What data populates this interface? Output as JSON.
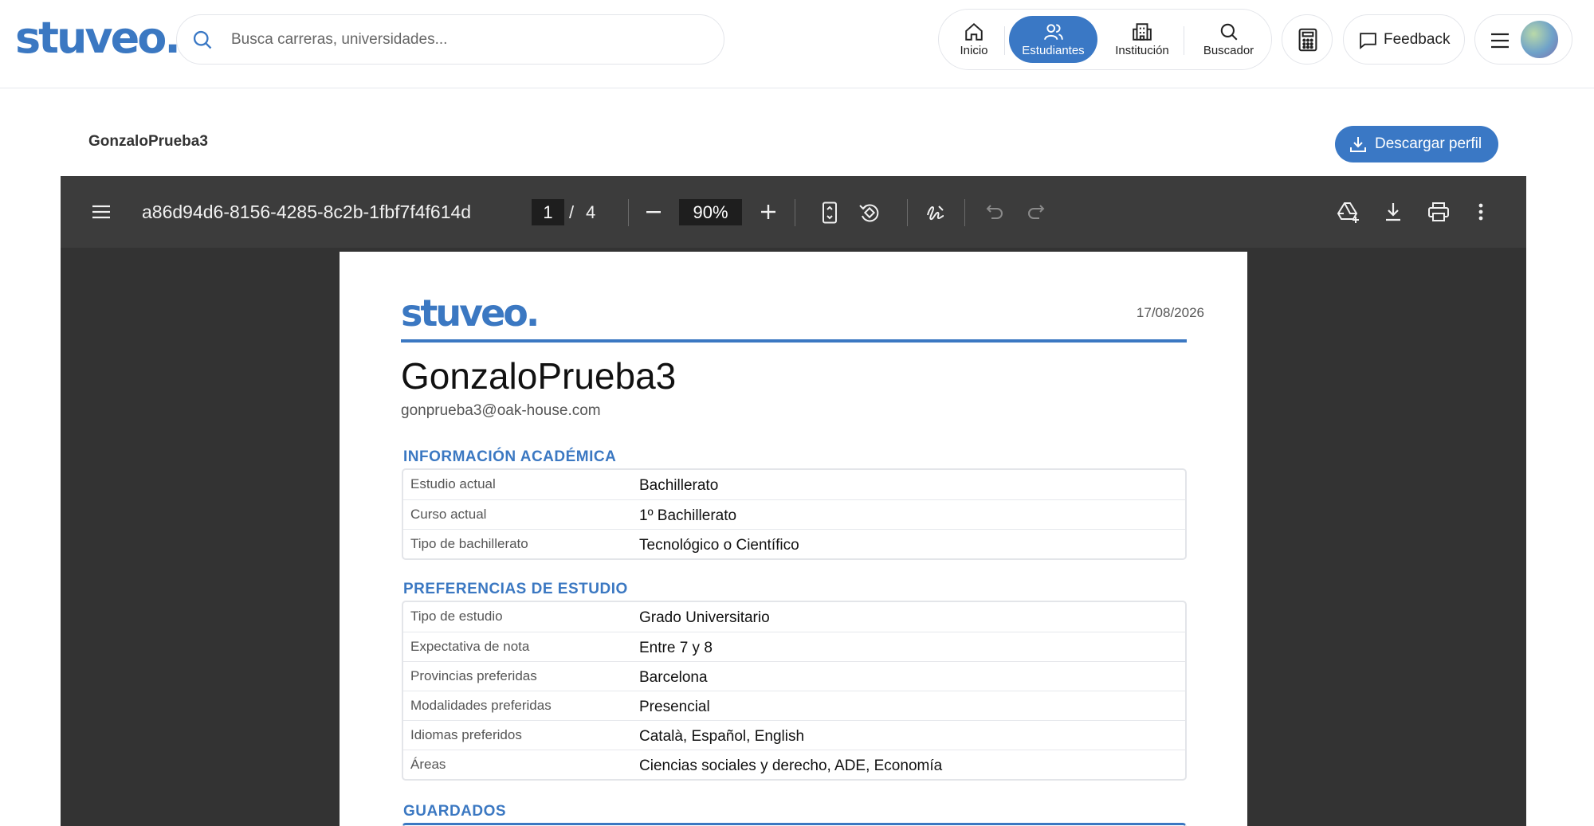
{
  "header": {
    "logo": "stuveo.",
    "search_placeholder": "Busca carreras, universidades...",
    "nav": [
      {
        "label": "Inicio",
        "icon": "home-icon"
      },
      {
        "label": "Estudiantes",
        "icon": "users-icon"
      },
      {
        "label": "Institución",
        "icon": "building-icon"
      },
      {
        "label": "Buscador",
        "icon": "search-icon"
      }
    ],
    "active_nav": "Estudiantes",
    "feedback_label": "Feedback"
  },
  "page": {
    "profile_name": "GonzaloPrueba3",
    "download_label": "Descargar perfil"
  },
  "viewer": {
    "file_name": "a86d94d6-8156-4285-8c2b-1fbf7f4f614d",
    "current_page": "1",
    "page_separator": "/",
    "total_pages": "4",
    "zoom": "90%"
  },
  "pdf": {
    "logo": "stuveo.",
    "date": "17/08/2026",
    "name": "GonzaloPrueba3",
    "email": "gonprueba3@oak-house.com",
    "sections": [
      {
        "title": "INFORMACIÓN ACADÉMICA",
        "rows": [
          {
            "key": "Estudio actual",
            "value": "Bachillerato"
          },
          {
            "key": "Curso actual",
            "value": "1º Bachillerato"
          },
          {
            "key": "Tipo de bachillerato",
            "value": "Tecnológico o Científico"
          }
        ]
      },
      {
        "title": "PREFERENCIAS DE ESTUDIO",
        "rows": [
          {
            "key": "Tipo de estudio",
            "value": "Grado Universitario"
          },
          {
            "key": "Expectativa de nota",
            "value": "Entre 7 y 8"
          },
          {
            "key": "Provincias preferidas",
            "value": "Barcelona"
          },
          {
            "key": "Modalidades preferidas",
            "value": "Presencial"
          },
          {
            "key": "Idiomas preferidos",
            "value": "Català, Español, English"
          },
          {
            "key": "Áreas",
            "value": "Ciencias sociales y derecho, ADE, Economía"
          }
        ]
      },
      {
        "title": "GUARDADOS",
        "rows": []
      }
    ]
  },
  "colors": {
    "brand": "#3b78c2",
    "viewer_bg": "#333333",
    "viewer_toolbar": "#3c3c3c"
  }
}
